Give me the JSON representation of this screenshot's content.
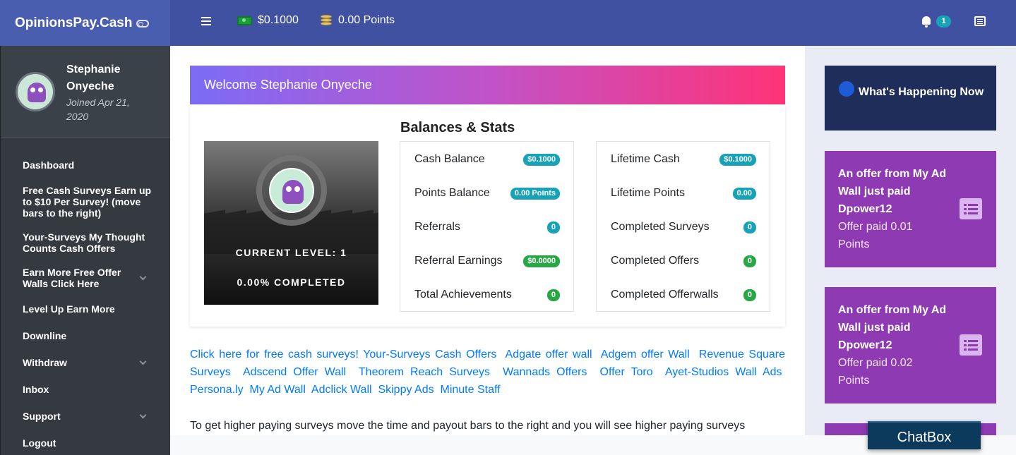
{
  "header": {
    "brand": "OpinionsPay.Cash",
    "cash": "$0.1000",
    "points": "0.00 Points",
    "notification_count": "1"
  },
  "user": {
    "name": "Stephanie Onyeche",
    "joined": "Joined Apr 21, 2020"
  },
  "sidebar": {
    "items": [
      {
        "label": "Dashboard"
      },
      {
        "label": "Free Cash Surveys Earn up to $10 Per Survey! (move bars to the right)"
      },
      {
        "label": "Your-Surveys My Thought Counts Cash Offers"
      },
      {
        "label": "Earn More Free Offer Walls Click Here"
      },
      {
        "label": "Level Up Earn More"
      },
      {
        "label": "Downline"
      },
      {
        "label": "Withdraw"
      },
      {
        "label": "Inbox"
      },
      {
        "label": "Support"
      },
      {
        "label": "Logout"
      }
    ]
  },
  "main": {
    "welcome": "Welcome Stephanie Onyeche",
    "stats_title": "Balances & Stats",
    "level": "CURRENT LEVEL: 1",
    "completed": "0.00% COMPLETED",
    "left_stats": [
      {
        "label": "Cash Balance",
        "value": "$0.1000"
      },
      {
        "label": "Points Balance",
        "value": "0.00 Points"
      },
      {
        "label": "Referrals",
        "value": "0"
      },
      {
        "label": "Referral Earnings",
        "value": "$0.0000"
      },
      {
        "label": "Total Achievements",
        "value": "0"
      }
    ],
    "right_stats": [
      {
        "label": "Lifetime Cash",
        "value": "$0.1000"
      },
      {
        "label": "Lifetime Points",
        "value": "0.00"
      },
      {
        "label": "Completed Surveys",
        "value": "0"
      },
      {
        "label": "Completed Offers",
        "value": "0"
      },
      {
        "label": "Completed Offerwalls",
        "value": "0"
      }
    ],
    "links": [
      "Click here for free cash surveys!",
      "Your-Surveys Cash Offers",
      "Adgate offer wall",
      "Adgem offer Wall",
      "Revenue Square Surveys",
      "Adscend Offer Wall",
      "Theorem Reach Surveys",
      "Wannads Offers",
      "Offer Toro",
      "Ayet-Studios Wall Ads",
      "Persona.ly",
      "My Ad Wall",
      "Adclick Wall",
      "Skippy Ads",
      "Minute Staff"
    ],
    "footer_text": "To get higher paying surveys move the time and payout bars to the right and you will see higher paying surveys"
  },
  "right": {
    "happening": "What's Happening Now",
    "offers": [
      {
        "title": "An offer from My Ad Wall just paid Dpower12",
        "paid": "Offer paid 0.01 Points"
      },
      {
        "title": "An offer from My Ad Wall just paid Dpower12",
        "paid": "Offer paid 0.02 Points"
      }
    ]
  },
  "chatbox": "ChatBox"
}
